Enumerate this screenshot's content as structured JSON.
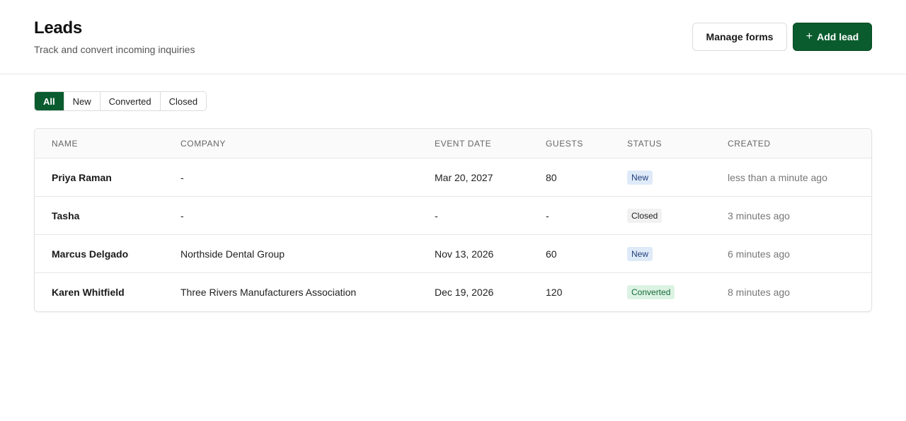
{
  "header": {
    "title": "Leads",
    "subtitle": "Track and convert incoming inquiries",
    "manage_forms_label": "Manage forms",
    "add_lead_icon": "+",
    "add_lead_label": "Add lead"
  },
  "filters": [
    {
      "label": "All",
      "active": true
    },
    {
      "label": "New",
      "active": false
    },
    {
      "label": "Converted",
      "active": false
    },
    {
      "label": "Closed",
      "active": false
    }
  ],
  "table": {
    "columns": [
      "NAME",
      "COMPANY",
      "EVENT DATE",
      "GUESTS",
      "STATUS",
      "CREATED"
    ],
    "rows": [
      {
        "name": "Priya Raman",
        "company": "-",
        "event_date": "Mar 20, 2027",
        "guests": "80",
        "status": "New",
        "created": "less than a minute ago"
      },
      {
        "name": "Tasha",
        "company": "-",
        "event_date": "-",
        "guests": "-",
        "status": "Closed",
        "created": "3 minutes ago"
      },
      {
        "name": "Marcus Delgado",
        "company": "Northside Dental Group",
        "event_date": "Nov 13, 2026",
        "guests": "60",
        "status": "New",
        "created": "6 minutes ago"
      },
      {
        "name": "Karen Whitfield",
        "company": "Three Rivers Manufacturers Association",
        "event_date": "Dec 19, 2026",
        "guests": "120",
        "status": "Converted",
        "created": "8 minutes ago"
      }
    ]
  },
  "colors": {
    "brand": "#0a5c2f",
    "badge_new_bg": "#dfeaf9",
    "badge_closed_bg": "#f1f1f1",
    "badge_converted_bg": "#dcf3e3"
  }
}
